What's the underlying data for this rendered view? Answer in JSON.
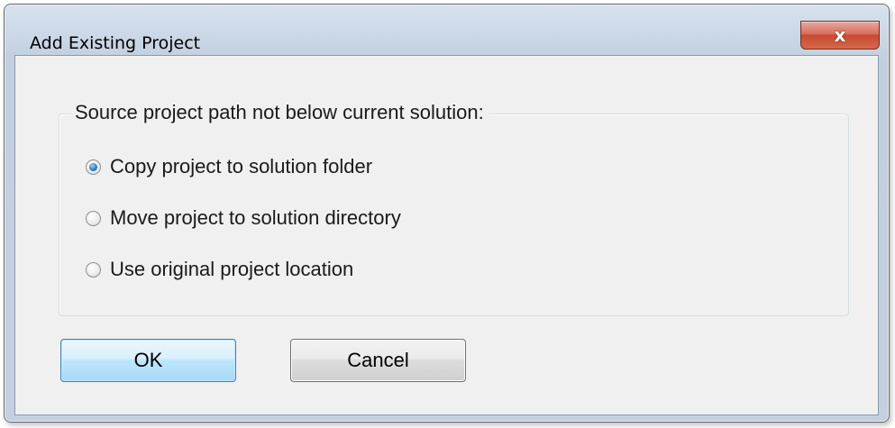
{
  "window": {
    "title": "Add Existing Project",
    "close_label": "x"
  },
  "group": {
    "legend": "Source project path not below current solution:",
    "options": [
      {
        "label": "Copy project to solution folder",
        "checked": true
      },
      {
        "label": "Move project to solution directory",
        "checked": false
      },
      {
        "label": "Use original project location",
        "checked": false
      }
    ]
  },
  "buttons": {
    "ok_label": "OK",
    "cancel_label": "Cancel"
  },
  "colors": {
    "close_button": "#c74a33",
    "ok_button_border": "#3c7fb1",
    "radio_selected": "#2f7dbf"
  }
}
